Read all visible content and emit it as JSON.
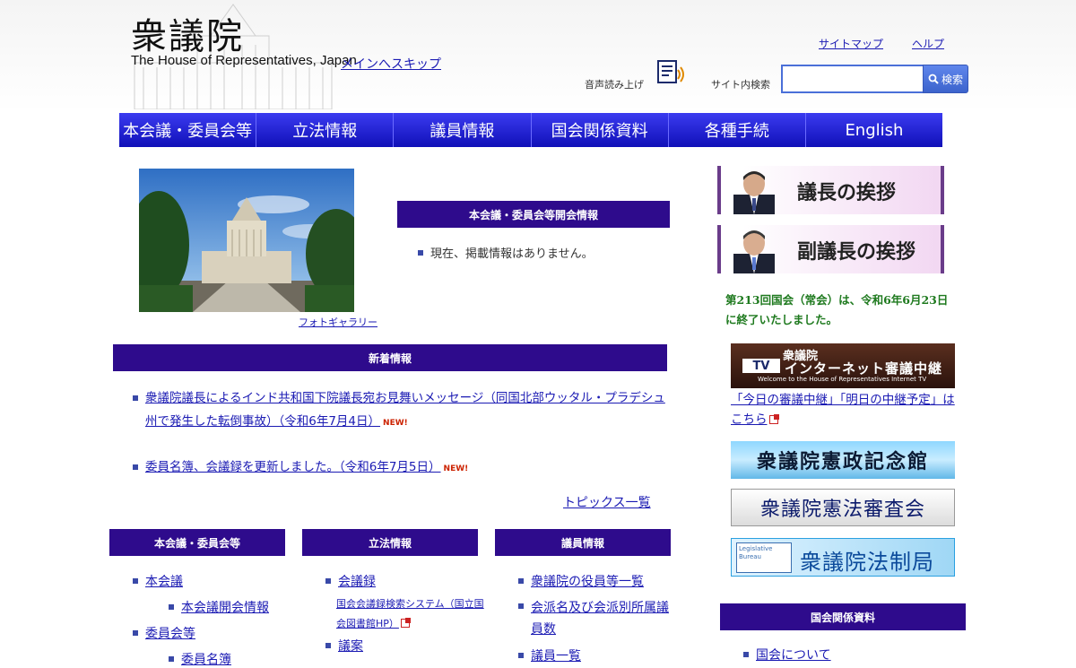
{
  "header": {
    "logo_kanji": "衆議院",
    "logo_english": "The House of Representatives, Japan",
    "skip_link": "メインへスキップ",
    "sitemap": "サイトマップ",
    "help": "ヘルプ",
    "voice_label": "音声読み上げ",
    "search_label": "サイト内検索",
    "search_value": "",
    "search_button": "検索"
  },
  "nav": [
    "本会議・委員会等",
    "立法情報",
    "議員情報",
    "国会関係資料",
    "各種手続",
    "English"
  ],
  "photo": {
    "gallery_link": "フォトギャラリー"
  },
  "meetings": {
    "heading": "本会議・委員会等開会情報",
    "message": "現在、掲載情報はありません。"
  },
  "news": {
    "heading": "新着情報",
    "new_badge": "NEW!",
    "items": [
      "衆議院議長によるインド共和国下院議長宛お見舞いメッセージ（同国北部ウッタル・プラデシュ州で発生した転倒事故）（令和6年7月4日）",
      "委員名簿、会議録を更新しました。（令和6年7月5日）"
    ],
    "topics_link": "トピックス一覧"
  },
  "columns": {
    "col1": {
      "heading": "本会議・委員会等",
      "links": [
        "本会議",
        "本会議開会情報",
        "委員会等",
        "委員名簿"
      ]
    },
    "col2": {
      "heading": "立法情報",
      "links": [
        "会議録",
        "国会会議録検索システム（国立国会図書館HP）",
        "議案"
      ]
    },
    "col3": {
      "heading": "議員情報",
      "links": [
        "衆議院の役員等一覧",
        "会派名及び会派別所属議員数",
        "議員一覧"
      ]
    }
  },
  "sidebar": {
    "speaker_greeting": "議長の挨拶",
    "vice_speaker_greeting": "副議長の挨拶",
    "diet_notice": "第213回国会（常会）は、令和6年6月23日に終了いたしました。",
    "tv": {
      "line1": "衆議院",
      "badge": "TV",
      "line2": "インターネット審議中継",
      "line3": "Welcome to the House of Representatives Internet TV",
      "link": "「今日の審議中継」「明日の中継予定」はこちら"
    },
    "kensei_banner": "衆議院憲政記念館",
    "kenpo_banner": "衆議院憲法審査会",
    "legal_logo": "Legislative Bureau",
    "legal_banner": "衆議院法制局",
    "related_heading": "国会関係資料",
    "related_links": [
      "国会について"
    ]
  },
  "colors": {
    "nav_blue": "#1010b8",
    "section_purple": "#2e0b8c",
    "notice_green": "#1f7a1f",
    "link_blue": "#1a1ab3"
  }
}
